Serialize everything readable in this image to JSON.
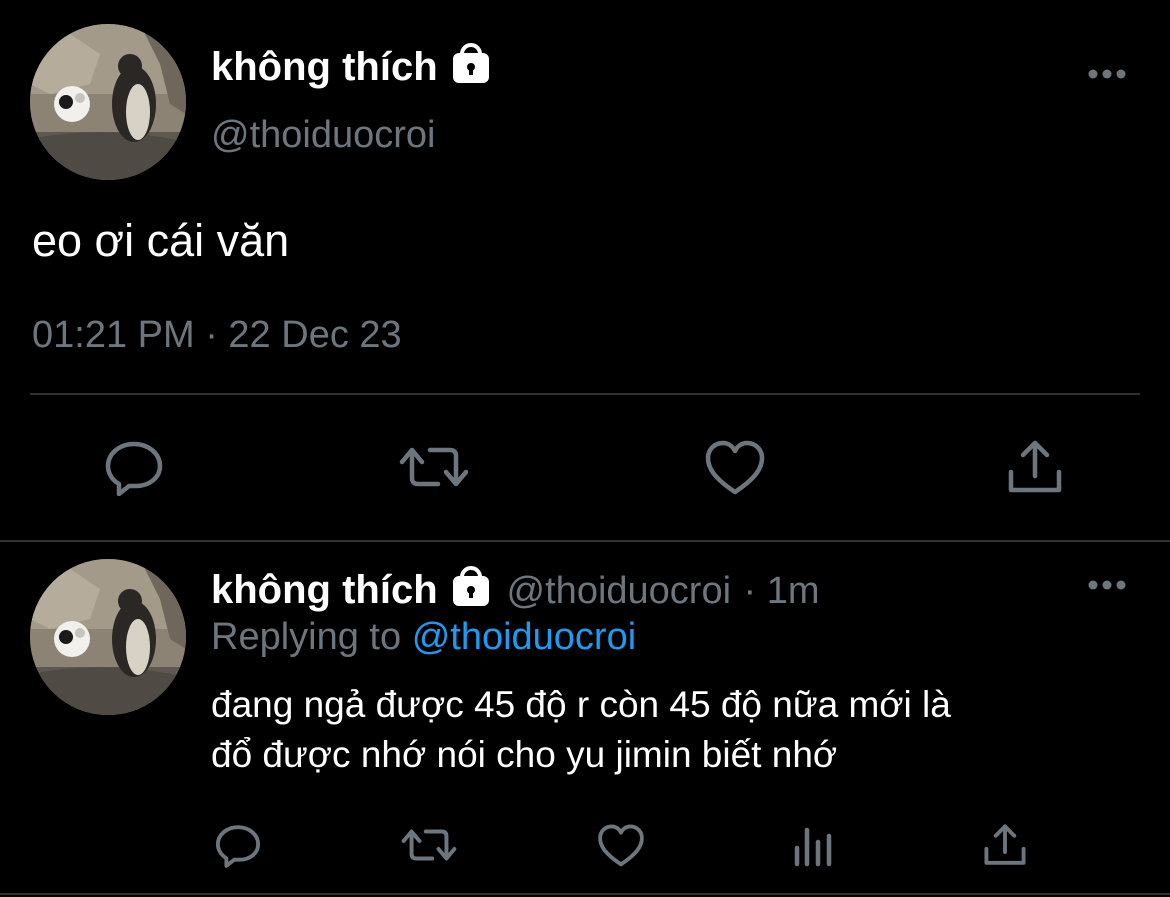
{
  "tweet": {
    "author": {
      "display_name": "không thích",
      "handle": "@thoiduocroi",
      "verified_lock": "lock-icon"
    },
    "text": "eo ơi cái văn",
    "timestamp": "01:21 PM · 22 Dec 23",
    "more_icon": "more-horizontal-icon",
    "actions": [
      "reply-icon",
      "retweet-icon",
      "like-icon",
      "share-icon"
    ]
  },
  "reply": {
    "author": {
      "display_name": "không thích",
      "handle": "@thoiduocroi",
      "time": "· 1m"
    },
    "replying_to_label": "Replying to",
    "replying_to_handle": "@thoiduocroi",
    "text_line1": "đang ngả được 45 độ r còn 45 độ nữa mới là",
    "text_line2": "đổ được nhớ nói cho yu jimin biết nhớ",
    "more_icon": "more-horizontal-icon",
    "actions": [
      "reply-icon",
      "retweet-icon",
      "like-icon",
      "analytics-icon",
      "share-icon"
    ]
  },
  "colors": {
    "background": "#000000",
    "text": "#ffffff",
    "muted": "#6e767d",
    "link": "#1d9bf0",
    "divider": "#2f3336"
  }
}
